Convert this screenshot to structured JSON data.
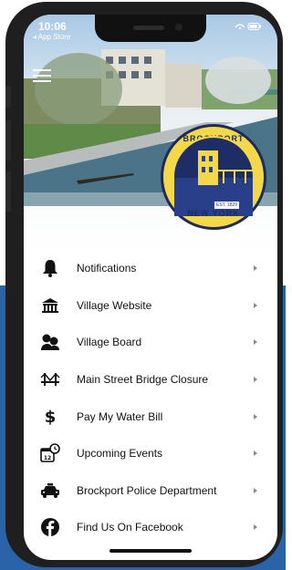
{
  "status_bar": {
    "time": "10:06",
    "back_label": "◂ App Store",
    "right_icons": "wifi battery"
  },
  "header": {
    "menu_icon": "hamburger-menu-icon",
    "seal": {
      "top_text": "BROCKPORT",
      "bottom_text": "NEW YORK",
      "est_text": "EST. 1829"
    }
  },
  "menu": {
    "items": [
      {
        "label": "Notifications",
        "icon": "bell-icon"
      },
      {
        "label": "Village Website",
        "icon": "building-icon"
      },
      {
        "label": "Village Board",
        "icon": "people-icon"
      },
      {
        "label": "Main Street Bridge Closure",
        "icon": "bridge-icon"
      },
      {
        "label": "Pay My Water Bill",
        "icon": "dollar-icon"
      },
      {
        "label": "Upcoming Events",
        "icon": "calendar-clock-icon"
      },
      {
        "label": "Brockport Police Department",
        "icon": "police-car-icon"
      },
      {
        "label": "Find Us On Facebook",
        "icon": "facebook-icon"
      }
    ]
  },
  "colors": {
    "background_accent": "#2b63a8",
    "phone_frame": "#1f1f1f",
    "seal_gold": "#f3d84a",
    "seal_navy": "#1f2d67"
  }
}
